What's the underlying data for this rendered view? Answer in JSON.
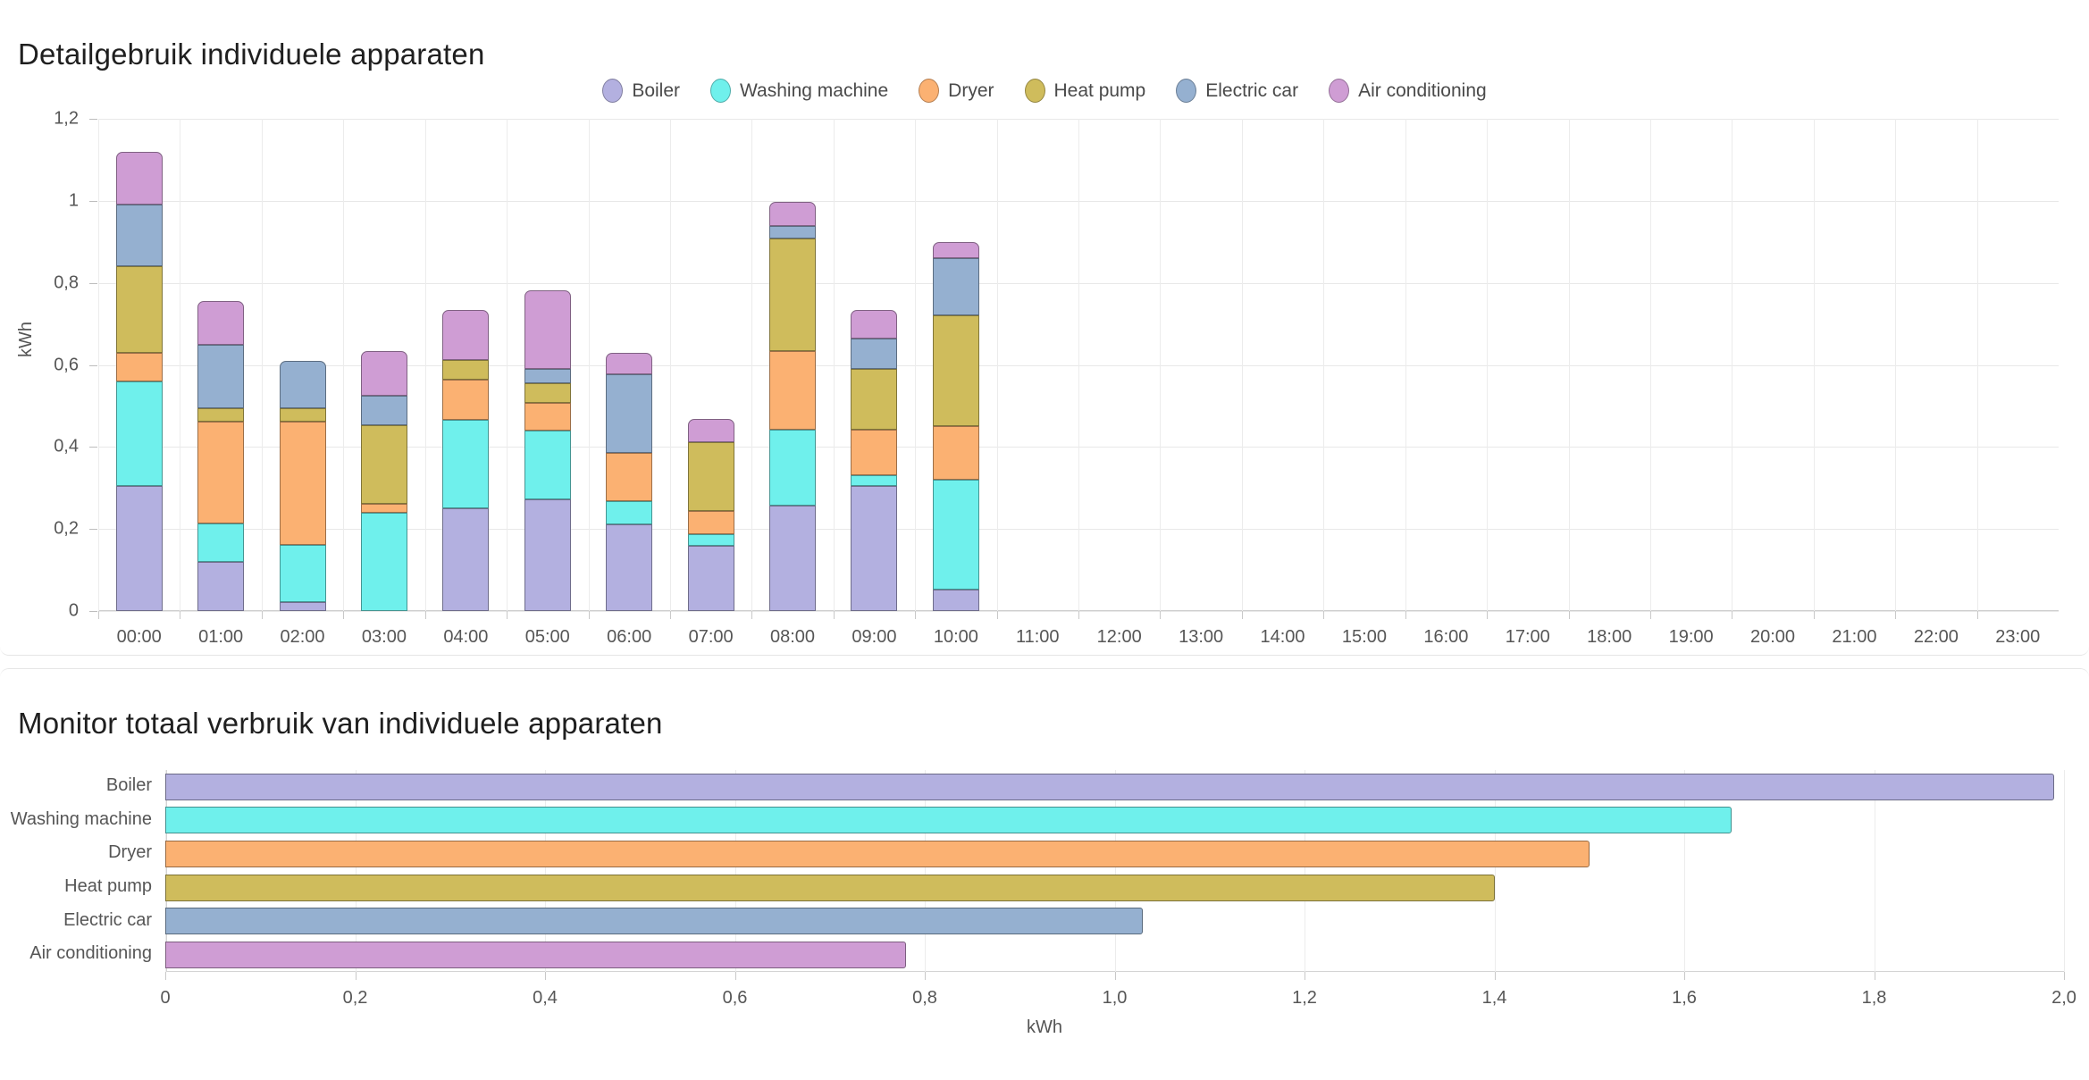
{
  "detail": {
    "title": "Detailgebruik individuele apparaten",
    "legend": [
      {
        "label": "Boiler",
        "color": "#b3b0e0"
      },
      {
        "label": "Washing machine",
        "color": "#6ff0ec"
      },
      {
        "label": "Dryer",
        "color": "#fbb172"
      },
      {
        "label": "Heat pump",
        "color": "#cfbc5c"
      },
      {
        "label": "Electric car",
        "color": "#95b0d0"
      },
      {
        "label": "Air conditioning",
        "color": "#cf9dd4"
      }
    ]
  },
  "total": {
    "title": "Monitor totaal verbruik van individuele apparaten"
  },
  "chart_data": [
    {
      "type": "bar",
      "id": "detail-stacked",
      "title": "Detailgebruik individuele apparaten",
      "stacked": true,
      "xlabel": "",
      "ylabel": "kWh",
      "ylim": [
        0,
        1.2
      ],
      "yticks": [
        0,
        0.2,
        0.4,
        0.6,
        0.8,
        1,
        1.2
      ],
      "ytick_labels": [
        "0",
        "0,2",
        "0,4",
        "0,6",
        "0,8",
        "1",
        "1,2"
      ],
      "grid": true,
      "legend_position": "top-center",
      "categories": [
        "00:00",
        "01:00",
        "02:00",
        "03:00",
        "04:00",
        "05:00",
        "06:00",
        "07:00",
        "08:00",
        "09:00",
        "10:00",
        "11:00",
        "12:00",
        "13:00",
        "14:00",
        "15:00",
        "16:00",
        "17:00",
        "18:00",
        "19:00",
        "20:00",
        "21:00",
        "22:00",
        "23:00"
      ],
      "series": [
        {
          "name": "Boiler",
          "color": "#b3b0e0",
          "values": [
            0.305,
            0.12,
            0.022,
            0.0,
            0.25,
            0.272,
            0.212,
            0.158,
            0.258,
            0.305,
            0.052,
            null,
            null,
            null,
            null,
            null,
            null,
            null,
            null,
            null,
            null,
            null,
            null,
            null
          ]
        },
        {
          "name": "Washing machine",
          "color": "#6ff0ec",
          "values": [
            0.255,
            0.093,
            0.14,
            0.24,
            0.215,
            0.168,
            0.055,
            0.03,
            0.185,
            0.025,
            0.268,
            null,
            null,
            null,
            null,
            null,
            null,
            null,
            null,
            null,
            null,
            null,
            null,
            null
          ]
        },
        {
          "name": "Dryer",
          "color": "#fbb172",
          "values": [
            0.07,
            0.248,
            0.3,
            0.022,
            0.098,
            0.068,
            0.118,
            0.055,
            0.19,
            0.112,
            0.13,
            null,
            null,
            null,
            null,
            null,
            null,
            null,
            null,
            null,
            null,
            null,
            null,
            null
          ]
        },
        {
          "name": "Heat pump",
          "color": "#cfbc5c",
          "values": [
            0.21,
            0.034,
            0.032,
            0.19,
            0.05,
            0.048,
            0.0,
            0.168,
            0.275,
            0.148,
            0.27,
            null,
            null,
            null,
            null,
            null,
            null,
            null,
            null,
            null,
            null,
            null,
            null,
            null
          ]
        },
        {
          "name": "Electric car",
          "color": "#95b0d0",
          "values": [
            0.15,
            0.155,
            0.115,
            0.072,
            0.0,
            0.035,
            0.192,
            0.0,
            0.03,
            0.075,
            0.14,
            null,
            null,
            null,
            null,
            null,
            null,
            null,
            null,
            null,
            null,
            null,
            null,
            null
          ]
        },
        {
          "name": "Air conditioning",
          "color": "#cf9dd4",
          "values": [
            0.13,
            0.105,
            0.0,
            0.11,
            0.122,
            0.19,
            0.052,
            0.058,
            0.06,
            0.068,
            0.04,
            null,
            null,
            null,
            null,
            null,
            null,
            null,
            null,
            null,
            null,
            null,
            null,
            null
          ]
        }
      ],
      "totals": [
        1.12,
        0.735,
        0.609,
        0.634,
        0.735,
        0.781,
        0.629,
        0.469,
        0.978,
        0.733,
        0.9
      ]
    },
    {
      "type": "bar",
      "id": "total-horizontal",
      "title": "Monitor totaal verbruik van individuele apparaten",
      "orientation": "horizontal",
      "xlabel": "kWh",
      "ylabel": "",
      "xlim": [
        0,
        2.0
      ],
      "xticks": [
        0,
        0.2,
        0.4,
        0.6,
        0.8,
        1.0,
        1.2,
        1.4,
        1.6,
        1.8,
        2.0
      ],
      "xtick_labels": [
        "0",
        "0,2",
        "0,4",
        "0,6",
        "0,8",
        "1,0",
        "1,2",
        "1,4",
        "1,6",
        "1,8",
        "2,0"
      ],
      "grid": true,
      "categories": [
        "Boiler",
        "Washing machine",
        "Dryer",
        "Heat pump",
        "Electric car",
        "Air conditioning"
      ],
      "values": [
        1.99,
        1.65,
        1.5,
        1.4,
        1.03,
        0.78
      ],
      "colors": [
        "#b3b0e0",
        "#6ff0ec",
        "#fbb172",
        "#cfbc5c",
        "#95b0d0",
        "#cf9dd4"
      ]
    }
  ]
}
